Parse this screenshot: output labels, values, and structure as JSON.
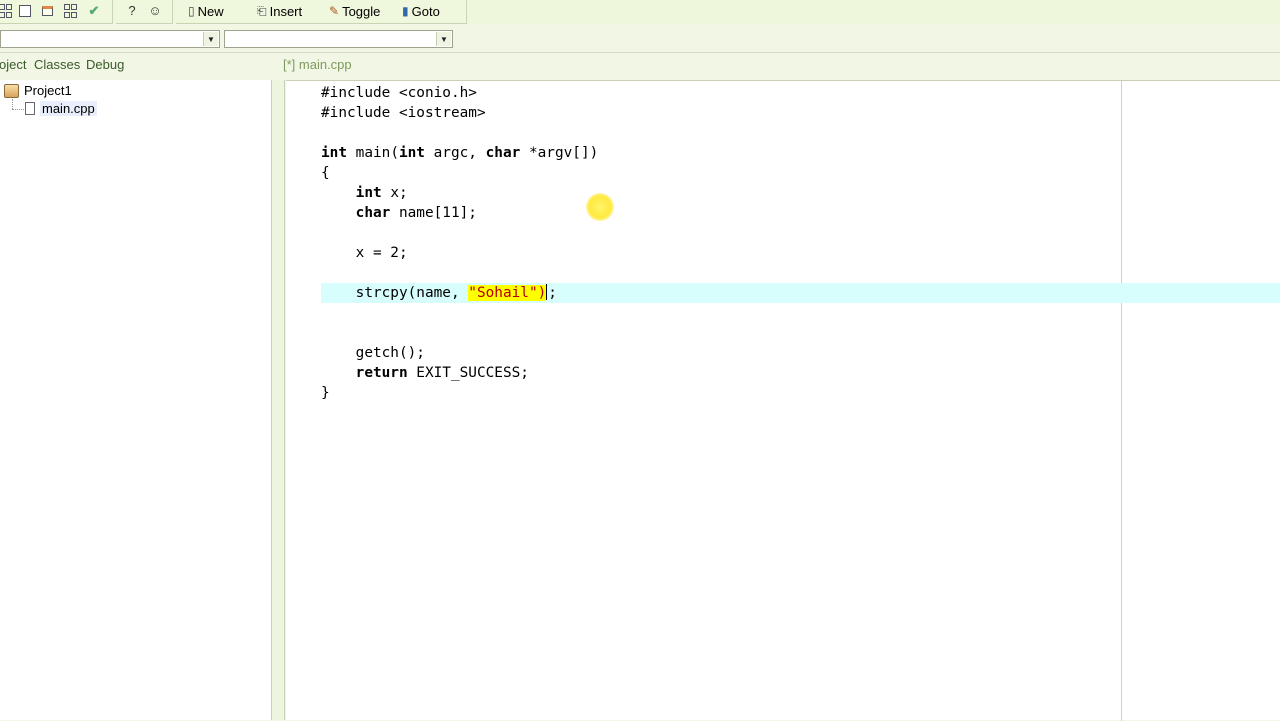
{
  "toolbar": {
    "group1_icons": [
      "grid-icon",
      "window-icon",
      "colored-grid-icon",
      "layout-icon",
      "checkmark-icon"
    ],
    "group2_icons": [
      "help-icon",
      "about-icon"
    ],
    "buttons": [
      {
        "icon": "new-file-icon",
        "label": "New"
      },
      {
        "icon": "insert-icon",
        "label": "Insert"
      },
      {
        "icon": "toggle-bookmark-icon",
        "label": "Toggle"
      },
      {
        "icon": "goto-bookmark-icon",
        "label": "Goto"
      }
    ]
  },
  "combos": {
    "class_combo_value": "",
    "member_combo_value": ""
  },
  "panel_tabs": [
    "oject",
    "Classes",
    "Debug"
  ],
  "editor_tabs": [
    {
      "label": "[*] main.cpp",
      "modified": true
    }
  ],
  "project_tree": {
    "project": "Project1",
    "files": [
      "main.cpp"
    ]
  },
  "editor": {
    "lines": [
      "#include <conio.h>",
      "#include <iostream>",
      "",
      "int main(int argc, char *argv[])",
      "{",
      "    int x;",
      "    char name[11];",
      "",
      "    x = 2;",
      "",
      "    strcpy(name, \"Sohail\");",
      "",
      "",
      "    getch();",
      "    return EXIT_SUCCESS;",
      "}"
    ],
    "current_line": 11,
    "highlight_color": "#d7fdfd",
    "selection_color": "#ffff00"
  },
  "colors": {
    "chrome_bg": "#f1f7e4",
    "tab_text": "#3a5a2a"
  }
}
